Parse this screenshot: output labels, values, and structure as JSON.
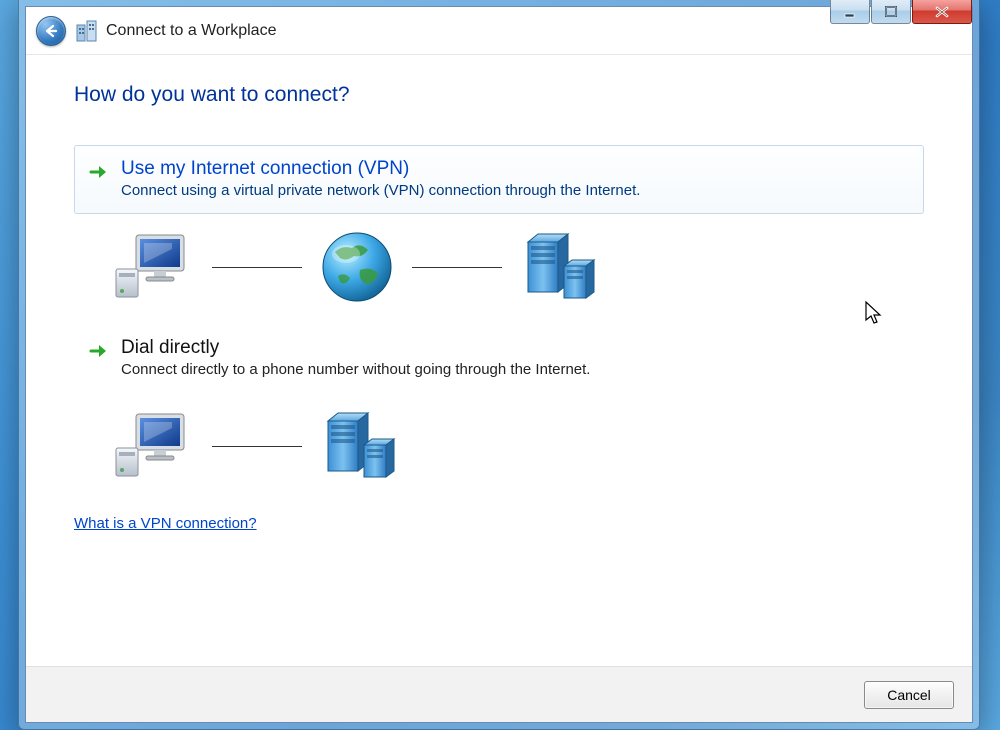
{
  "window": {
    "title": "Connect to a Workplace",
    "icons": {
      "back": "back-arrow-icon",
      "header": "workplace-buildings-icon",
      "minimize": "minimize-icon",
      "maximize": "maximize-icon",
      "close": "close-icon"
    }
  },
  "page": {
    "heading": "How do you want to connect?",
    "options": [
      {
        "id": "vpn",
        "title": "Use my Internet connection (VPN)",
        "desc": "Connect using a virtual private network (VPN) connection through the Internet.",
        "hover": true,
        "diagram": [
          "computer",
          "globe",
          "server"
        ]
      },
      {
        "id": "dial",
        "title": "Dial directly",
        "desc": "Connect directly to a phone number without going through the Internet.",
        "hover": false,
        "diagram": [
          "computer",
          "server"
        ]
      }
    ],
    "help_link": "What is a VPN connection?"
  },
  "footer": {
    "cancel_label": "Cancel"
  }
}
